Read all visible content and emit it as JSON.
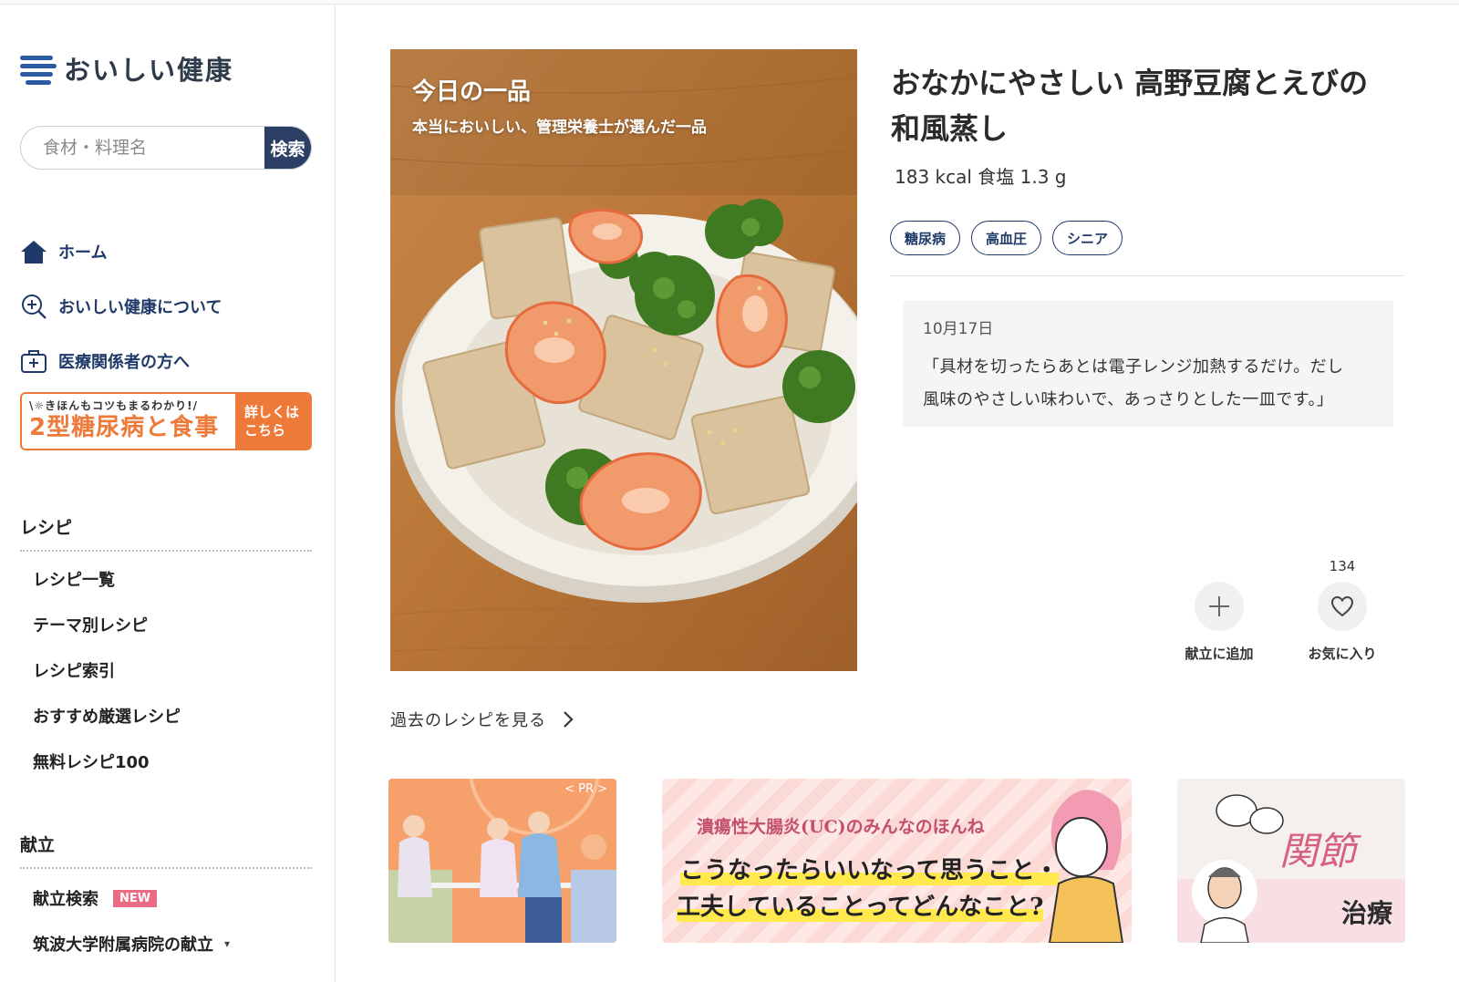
{
  "brand": {
    "name": "おいしい健康",
    "color": "#2c5aa0"
  },
  "search": {
    "placeholder": "食材・料理名",
    "button_label": "検索"
  },
  "nav": [
    {
      "icon": "home-icon",
      "label": "ホーム"
    },
    {
      "icon": "zoom-plus-icon",
      "label": "おいしい健康について"
    },
    {
      "icon": "medical-kit-icon",
      "label": "医療関係者の方へ"
    }
  ],
  "diabetes_banner": {
    "tagline": "\\☼きほんもコツもまるわかり!/",
    "title": "2型糖尿病と食事",
    "cta_line1": "詳しくは",
    "cta_line2": "こちら"
  },
  "recipes_section": {
    "title": "レシピ",
    "items": [
      "レシピ一覧",
      "テーマ別レシピ",
      "レシピ索引",
      "おすすめ厳選レシピ",
      "無料レシピ100"
    ]
  },
  "menu_section": {
    "title": "献立",
    "items": [
      {
        "label": "献立検索",
        "badge": "NEW"
      },
      {
        "label": "筑波大学附属病院の献立",
        "caret": "▾"
      }
    ]
  },
  "hero": {
    "heading": "今日の一品",
    "subheading": "本当においしい、管理栄養士が選んだ一品"
  },
  "recipe": {
    "title_line1": "おなかにやさしい 高野豆腐とえびの",
    "title_line2": "和風蒸し",
    "nutrition": "183 kcal 食塩 1.3 g",
    "tags": [
      "糖尿病",
      "高血圧",
      "シニア"
    ],
    "comment_date": "10月17日",
    "comment_line1": "「具材を切ったらあとは電子レンジ加熱するだけ。だし",
    "comment_line2": "風味のやさしい味わいで、あっさりとした一皿です。」"
  },
  "actions": {
    "add_label": "献立に追加",
    "fav_label": "お気に入り",
    "fav_count": "134"
  },
  "past_link": "過去のレシピを見る",
  "promos": {
    "pr_label": "< PR >",
    "uc_subtitle": "潰瘍性大腸炎(UC)のみんなのほんね",
    "uc_line1": "こうなったらいいなって思うこと・",
    "uc_line2": "工夫していることってどんなこと?",
    "joint_text1": "関節",
    "joint_text2": "治療"
  }
}
